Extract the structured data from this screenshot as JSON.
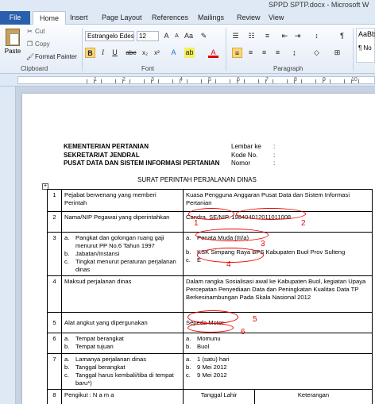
{
  "window": {
    "title": "SPPD SPTP.docx - Microsoft W"
  },
  "tabs": [
    {
      "label": "File"
    },
    {
      "label": "Home"
    },
    {
      "label": "Insert"
    },
    {
      "label": "Page Layout"
    },
    {
      "label": "References"
    },
    {
      "label": "Mailings"
    },
    {
      "label": "Review"
    },
    {
      "label": "View"
    }
  ],
  "ribbon": {
    "clipboard": {
      "paste": "Paste",
      "cut": "Cut",
      "copy": "Copy",
      "format_painter": "Format Painter",
      "label": "Clipboard"
    },
    "font": {
      "name": "Estrangelo Edes",
      "size": "12",
      "label": "Font",
      "bold": "B",
      "italic": "I",
      "underline": "U",
      "strike": "abe",
      "subscript": "x₂",
      "superscript": "x²"
    },
    "paragraph": {
      "label": "Paragraph"
    },
    "styles": {
      "preview": "AaBb",
      "name": "¶ No"
    }
  },
  "ruler": {
    "numbers": [
      "1",
      "2",
      "3",
      "4",
      "5",
      "6",
      "7",
      "8",
      "9",
      "10"
    ]
  },
  "header": {
    "left": [
      "KEMENTERIAN PERTANIAN",
      "SEKRETARIAT JENDRAL",
      "PUSAT DATA DAN SISTEM INFORMASI PERTANIAN"
    ],
    "right_labels": [
      "Lembar ke",
      "Kode No.",
      "Nomor"
    ],
    "colon": ":"
  },
  "doc_title": "SURAT PERINTAH PERJALANAN DINAS",
  "table": {
    "rows": [
      {
        "no": "1",
        "left": "Pejabat berwenang yang memberi Perintah",
        "right": "Kuasa Pengguna Anggaran Pusat Data dan Sistem Informasi Pertanian"
      },
      {
        "no": "2",
        "left": "Nama/NIP Pegawai yang diperintahkan",
        "right": "Candra, SE/NIP. 198404012011011008"
      },
      {
        "no": "3",
        "left_items": [
          {
            "m": "a.",
            "t": "Pangkat dan golongan  ruang gaji menurut PP No.6  Tahun 1997"
          },
          {
            "m": "b.",
            "t": "Jabatan/Instansi"
          },
          {
            "m": "c.",
            "t": "Tingkat menurut peraturan perjalanan dinas"
          }
        ],
        "right_items": [
          {
            "m": "a.",
            "t": "Penata Muda (III/a)"
          },
          {
            "m": "b.",
            "t": "KSK Simpang Raya BPS Kabupaten Buol Prov Sulteng"
          },
          {
            "m": "c.",
            "t": "E"
          }
        ]
      },
      {
        "no": "4",
        "left": "Maksud perjalanan dinas",
        "right": "Dalam rangka  Sosialisasi awal ke Kabupaten Buol, kegiatan Upaya Percepatan Penyediaan Data dan Peningkatan Kualitas Data TP Berkesinambungan Pada Skala Nasional 2012"
      },
      {
        "no": "5",
        "left": "Alat angkut yang dipergunakan",
        "right": "Sepeda Motor"
      },
      {
        "no": "6",
        "left_items": [
          {
            "m": "a.",
            "t": "Tempat berangkat"
          },
          {
            "m": "b.",
            "t": "Tempat tujuan"
          }
        ],
        "right_items": [
          {
            "m": "a.",
            "t": "Momunu"
          },
          {
            "m": "b.",
            "t": "Buol"
          }
        ]
      },
      {
        "no": "7",
        "left_items": [
          {
            "m": "a.",
            "t": "Lamanya perjalanan dinas"
          },
          {
            "m": "b.",
            "t": "Tanggal berangkat"
          },
          {
            "m": "c.",
            "t": "Tanggal harus kembali/tiba di    tempat baru*)"
          }
        ],
        "right_items": [
          {
            "m": "a.",
            "t": "1 (satu) hari"
          },
          {
            "m": "b.",
            "t": "9 Mei 2012"
          },
          {
            "m": "c.",
            "t": "9 Mei 2012"
          }
        ]
      },
      {
        "no": "8",
        "left": "Pengikut :              N a m a",
        "mid": "Tanggal Lahir",
        "right": "Keterangan"
      }
    ]
  },
  "annotations": [
    "1",
    "2",
    "3",
    "4",
    "5",
    "6"
  ],
  "colors": {
    "annotation": "#e00000",
    "file_tab": "#2a5fad",
    "ribbon_bg": "#dfe9f5"
  }
}
